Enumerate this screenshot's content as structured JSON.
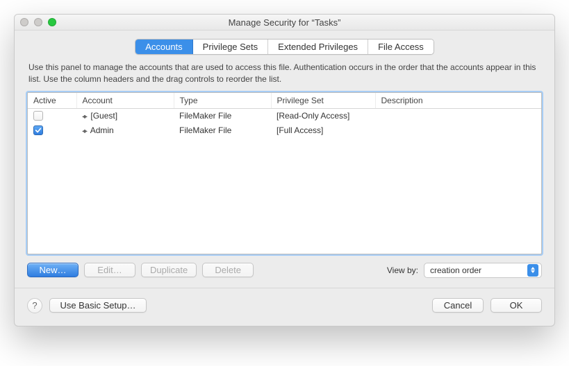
{
  "window": {
    "title": "Manage Security for “Tasks”"
  },
  "tabs": {
    "accounts": "Accounts",
    "privilege_sets": "Privilege Sets",
    "extended": "Extended Privileges",
    "file_access": "File Access"
  },
  "description": "Use this panel to manage the accounts that are used to access this file.  Authentication occurs in the order that the accounts appear in this list.  Use the column headers and the drag controls to reorder the list.",
  "columns": {
    "active": "Active",
    "account": "Account",
    "type": "Type",
    "priv": "Privilege Set",
    "desc": "Description"
  },
  "rows": [
    {
      "active": false,
      "account": "[Guest]",
      "type": "FileMaker File",
      "priv": "[Read-Only Access]",
      "desc": ""
    },
    {
      "active": true,
      "account": "Admin",
      "type": "FileMaker File",
      "priv": "[Full Access]",
      "desc": ""
    }
  ],
  "buttons": {
    "new": "New…",
    "edit": "Edit…",
    "duplicate": "Duplicate",
    "delete": "Delete",
    "basic": "Use Basic Setup…",
    "cancel": "Cancel",
    "ok": "OK"
  },
  "viewby": {
    "label": "View by:",
    "value": "creation order"
  }
}
